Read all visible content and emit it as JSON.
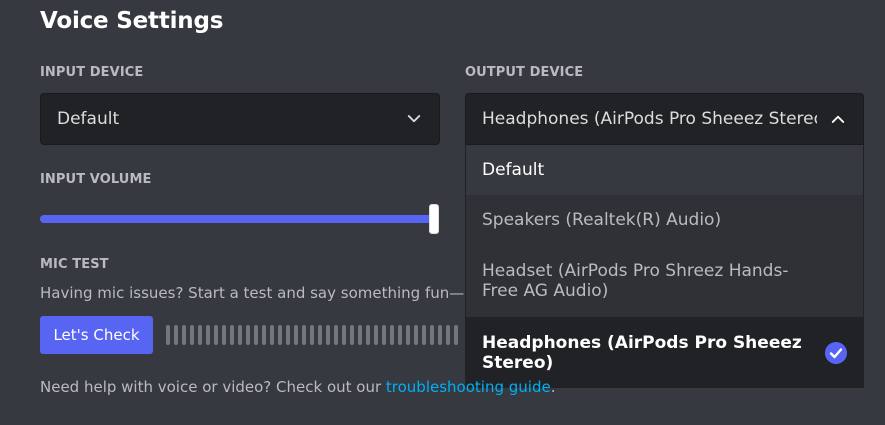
{
  "page_title": "Voice Settings",
  "input_device": {
    "label": "INPUT DEVICE",
    "value": "Default",
    "icon": "chevron-down-icon"
  },
  "output_device": {
    "label": "OUTPUT DEVICE",
    "value": "Headphones (AirPods Pro Sheeez Stereo)",
    "icon": "chevron-up-icon",
    "options": [
      {
        "label": "Default",
        "state": "hover"
      },
      {
        "label": "Speakers (Realtek(R) Audio)",
        "state": "normal"
      },
      {
        "label": "Headset (AirPods Pro Shreez Hands-Free AG Audio)",
        "state": "normal"
      },
      {
        "label": "Headphones (AirPods Pro Sheeez Stereo)",
        "state": "selected"
      }
    ]
  },
  "input_volume": {
    "label": "INPUT VOLUME",
    "level_percent": 100
  },
  "mic_test": {
    "label": "MIC TEST",
    "description": "Having mic issues? Start a test and say something fun—we",
    "button_label": "Let's Check"
  },
  "help": {
    "text_before": "Need help with voice or video? Check out our ",
    "link_text": "troubleshooting guide",
    "text_after": "."
  },
  "colors": {
    "background": "#36393f",
    "accent": "#5865f2",
    "link": "#00aff4",
    "field": "#202225"
  }
}
